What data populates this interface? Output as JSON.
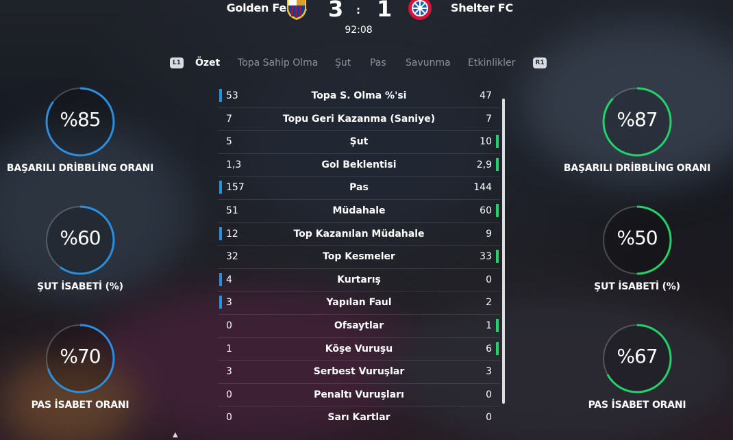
{
  "match": {
    "home_team": "Golden Fellas",
    "away_team": "Shelter FC",
    "home_score": "3",
    "away_score": "1",
    "score_separator": ":",
    "clock": "92:08"
  },
  "colors": {
    "home": "#2b8fe0",
    "away": "#22d36a"
  },
  "tabs": {
    "left_key": "L1",
    "right_key": "R1",
    "items": [
      "Özet",
      "Topa Sahip Olma",
      "Şut",
      "Pas",
      "Savunma",
      "Etkinlikler"
    ],
    "active": "Özet"
  },
  "home_gauges": [
    {
      "value": "%85",
      "label": "BAŞARILI DRİBBLİNG ORANI",
      "percent": 85
    },
    {
      "value": "%60",
      "label": "ŞUT İSABETİ (%)",
      "percent": 60
    },
    {
      "value": "%70",
      "label": "PAS İSABET ORANI",
      "percent": 70
    }
  ],
  "away_gauges": [
    {
      "value": "%87",
      "label": "BAŞARILI DRİBBLİNG ORANI",
      "percent": 87
    },
    {
      "value": "%50",
      "label": "ŞUT İSABETİ (%)",
      "percent": 50
    },
    {
      "value": "%67",
      "label": "PAS İSABET ORANI",
      "percent": 67
    }
  ],
  "stats": [
    {
      "home": "53",
      "label": "Topa S. Olma %'si",
      "away": "47",
      "lead": "home"
    },
    {
      "home": "7",
      "label": "Topu Geri Kazanma (Saniye)",
      "away": "7",
      "lead": "none"
    },
    {
      "home": "5",
      "label": "Şut",
      "away": "10",
      "lead": "away"
    },
    {
      "home": "1,3",
      "label": "Gol Beklentisi",
      "away": "2,9",
      "lead": "away"
    },
    {
      "home": "157",
      "label": "Pas",
      "away": "144",
      "lead": "home"
    },
    {
      "home": "51",
      "label": "Müdahale",
      "away": "60",
      "lead": "away"
    },
    {
      "home": "12",
      "label": "Top Kazanılan Müdahale",
      "away": "9",
      "lead": "home"
    },
    {
      "home": "32",
      "label": "Top Kesmeler",
      "away": "33",
      "lead": "away"
    },
    {
      "home": "4",
      "label": "Kurtarış",
      "away": "0",
      "lead": "home"
    },
    {
      "home": "3",
      "label": "Yapılan Faul",
      "away": "2",
      "lead": "home"
    },
    {
      "home": "0",
      "label": "Ofsaytlar",
      "away": "1",
      "lead": "away"
    },
    {
      "home": "1",
      "label": "Köşe Vuruşu",
      "away": "6",
      "lead": "away"
    },
    {
      "home": "3",
      "label": "Serbest Vuruşlar",
      "away": "3",
      "lead": "none"
    },
    {
      "home": "0",
      "label": "Penaltı Vuruşları",
      "away": "0",
      "lead": "none"
    },
    {
      "home": "0",
      "label": "Sarı Kartlar",
      "away": "0",
      "lead": "none"
    }
  ],
  "icons": {
    "home_crest": "fc-barcelona-crest",
    "away_crest": "bayern-munich-crest",
    "scroll_caret": "caret-up-icon"
  }
}
